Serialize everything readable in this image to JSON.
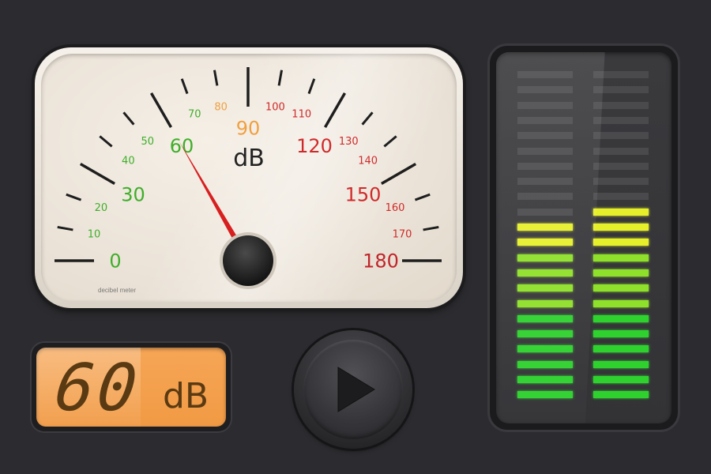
{
  "gauge": {
    "unit_label": "dB",
    "caption": "decibel meter",
    "value": 60,
    "min": 0,
    "max": 180,
    "major_labels": [
      {
        "value": 0,
        "text": "0",
        "color": "#3fae2a"
      },
      {
        "value": 30,
        "text": "30",
        "color": "#3fae2a"
      },
      {
        "value": 60,
        "text": "60",
        "color": "#3fae2a"
      },
      {
        "value": 90,
        "text": "90",
        "color": "#f0a040"
      },
      {
        "value": 120,
        "text": "120",
        "color": "#d02a2a"
      },
      {
        "value": 150,
        "text": "150",
        "color": "#d02a2a"
      },
      {
        "value": 180,
        "text": "180",
        "color": "#c0242a"
      }
    ],
    "minor_labels": [
      {
        "value": 10,
        "text": "10",
        "color": "#3fae2a"
      },
      {
        "value": 20,
        "text": "20",
        "color": "#3fae2a"
      },
      {
        "value": 40,
        "text": "40",
        "color": "#3fae2a"
      },
      {
        "value": 50,
        "text": "50",
        "color": "#3fae2a"
      },
      {
        "value": 70,
        "text": "70",
        "color": "#3fae2a"
      },
      {
        "value": 80,
        "text": "80",
        "color": "#f0a040"
      },
      {
        "value": 100,
        "text": "100",
        "color": "#d02a2a"
      },
      {
        "value": 110,
        "text": "110",
        "color": "#d02a2a"
      },
      {
        "value": 130,
        "text": "130",
        "color": "#d02a2a"
      },
      {
        "value": 140,
        "text": "140",
        "color": "#d02a2a"
      },
      {
        "value": 160,
        "text": "160",
        "color": "#d02a2a"
      },
      {
        "value": 170,
        "text": "170",
        "color": "#d02a2a"
      }
    ],
    "needle_color": "#d81f1f"
  },
  "lcd": {
    "value": "60",
    "unit": "dB",
    "background": "#f19a44"
  },
  "play_button": {
    "icon": "play-icon"
  },
  "level_meter": {
    "channels": [
      {
        "name": "left",
        "level_fraction": 0.55
      },
      {
        "name": "right",
        "level_fraction": 0.6
      }
    ],
    "colors": {
      "low": "#2fd12f",
      "mid": "#8fe02a",
      "high": "#e6f02a",
      "off": "#4a4a4d"
    }
  }
}
